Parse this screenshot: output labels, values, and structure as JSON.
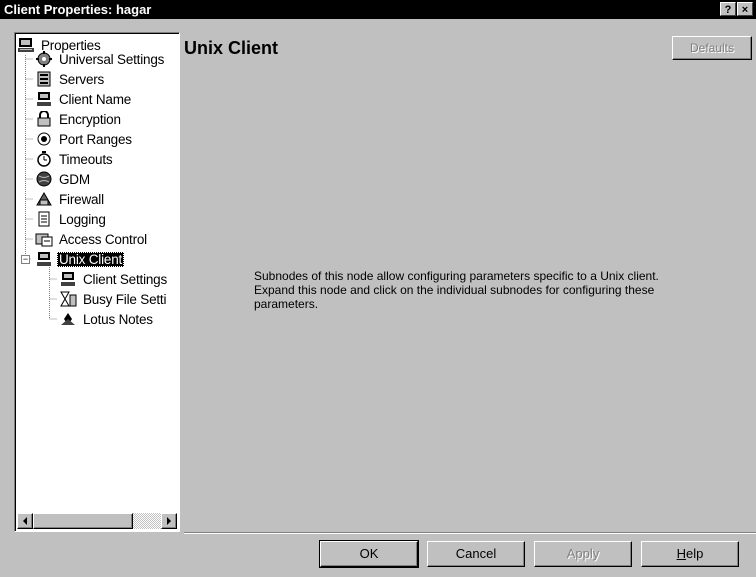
{
  "window": {
    "title": "Client Properties: hagar",
    "help_label": "?",
    "close_label": "×"
  },
  "tree": {
    "items": [
      {
        "label": "Properties",
        "icon": "computer-icon"
      },
      {
        "label": "Universal Settings",
        "icon": "settings-gear-icon"
      },
      {
        "label": "Servers",
        "icon": "server-icon"
      },
      {
        "label": "Client Name",
        "icon": "computer-icon"
      },
      {
        "label": "Encryption",
        "icon": "lock-icon"
      },
      {
        "label": "Port Ranges",
        "icon": "radio-port-icon"
      },
      {
        "label": "Timeouts",
        "icon": "stopwatch-icon"
      },
      {
        "label": "GDM",
        "icon": "globe-icon"
      },
      {
        "label": "Firewall",
        "icon": "firewall-icon"
      },
      {
        "label": "Logging",
        "icon": "log-file-icon"
      },
      {
        "label": "Access Control",
        "icon": "access-control-icon"
      },
      {
        "label": "Unix Client",
        "icon": "computer-icon",
        "selected": true
      },
      {
        "label": "Client Settings",
        "icon": "computer-icon"
      },
      {
        "label": "Busy File Setti",
        "icon": "hourglass-icon"
      },
      {
        "label": "Lotus Notes",
        "icon": "lotus-notes-icon"
      }
    ],
    "collapse_symbol": "−"
  },
  "panel": {
    "title": "Unix Client",
    "defaults_label": "Defaults",
    "description": "Subnodes of this node allow configuring parameters specific to a Unix client. Expand this node and click on the individual  subnodes for configuring these parameters."
  },
  "buttons": {
    "ok": "OK",
    "cancel": "Cancel",
    "apply": "Apply",
    "help_prefix": "",
    "help_underlined": "H",
    "help_rest": "elp"
  }
}
